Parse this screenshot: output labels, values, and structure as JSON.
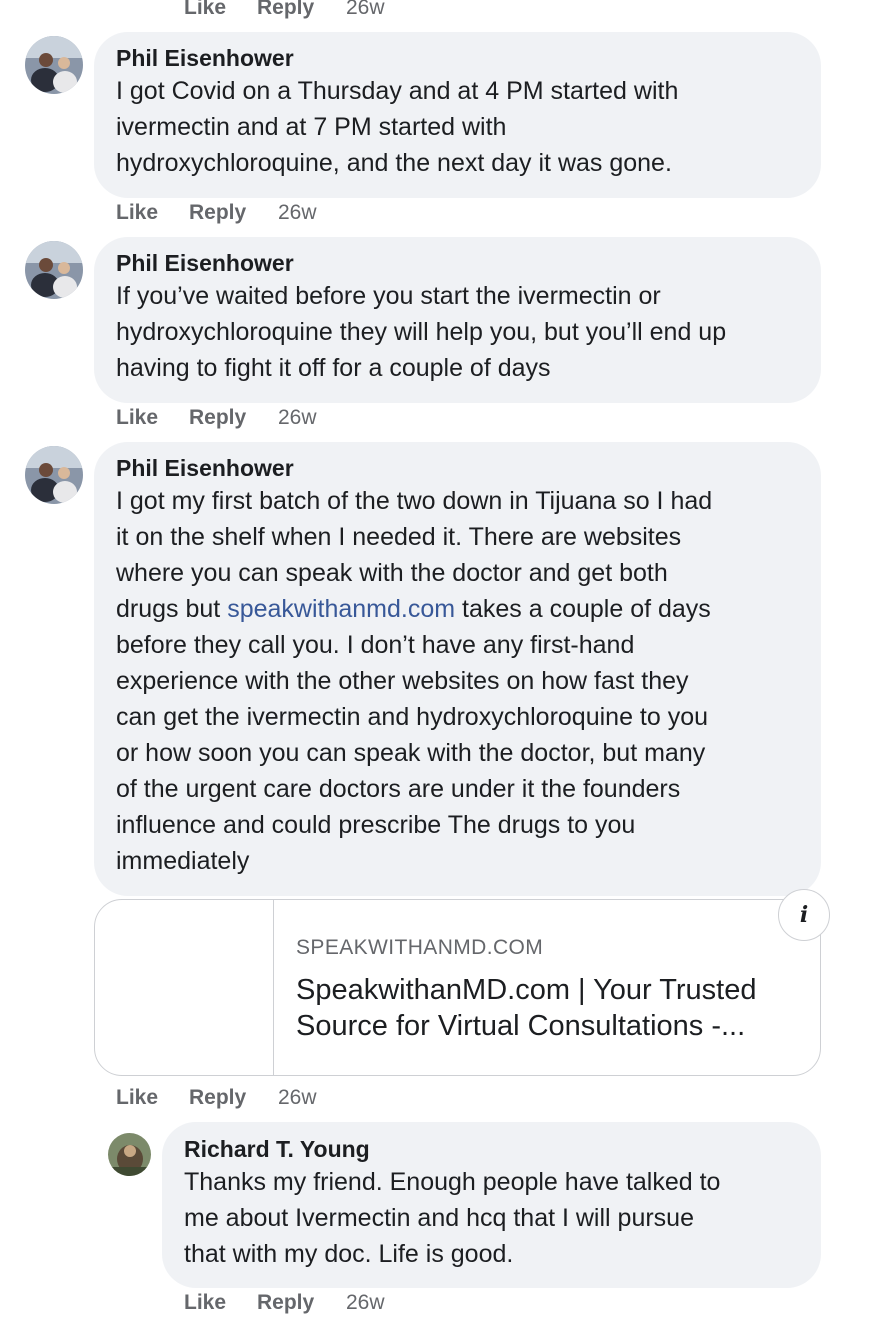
{
  "top_actions": {
    "like": "Like",
    "reply": "Reply",
    "time": "26w"
  },
  "comments": [
    {
      "author": "Phil Eisenhower",
      "lines": [
        "I got Covid on a Thursday and at 4 PM started with",
        "ivermectin and at 7 PM started with",
        "hydroxychloroquine, and the next day it was gone."
      ],
      "actions": {
        "like": "Like",
        "reply": "Reply",
        "time": "26w"
      }
    },
    {
      "author": "Phil Eisenhower",
      "lines": [
        "If you’ve waited before you start the ivermectin or",
        "hydroxychloroquine they will help you, but you’ll end up",
        "having to fight it off for a couple of days"
      ],
      "actions": {
        "like": "Like",
        "reply": "Reply",
        "time": "26w"
      }
    },
    {
      "author": "Phil Eisenhower",
      "lines": [
        "I got my first batch of the two down in Tijuana so I had",
        "it on the shelf when I needed it. There are websites",
        "where you can speak with the doctor and get both",
        "drugs but ",
        "before they call you. I don’t have any first-hand",
        "experience with the other websites on how fast they",
        "can get the ivermectin and hydroxychloroquine to you",
        "or how soon you can speak with the doctor, but many",
        "of the urgent care doctors are under it the founders",
        "influence and could prescribe The drugs to you",
        "immediately"
      ],
      "link_text": "speakwithanmd.com",
      "after_link": " takes a couple of days",
      "actions": {
        "like": "Like",
        "reply": "Reply",
        "time": "26w"
      }
    },
    {
      "author": "Richard T. Young",
      "lines": [
        "Thanks my friend. Enough people have talked to",
        "me about Ivermectin and hcq that I will pursue",
        "that with my doc. Life is good."
      ],
      "actions": {
        "like": "Like",
        "reply": "Reply",
        "time": "26w"
      }
    }
  ],
  "link_preview": {
    "domain": "SPEAKWITHANMD.COM",
    "title": "SpeakwithanMD.com | Your Trusted Source for Virtual Consultations -...",
    "info_icon": "info-icon",
    "info_glyph": "i"
  },
  "colors": {
    "bubble": "#f0f2f5",
    "link": "#385898",
    "meta": "#65676b"
  }
}
